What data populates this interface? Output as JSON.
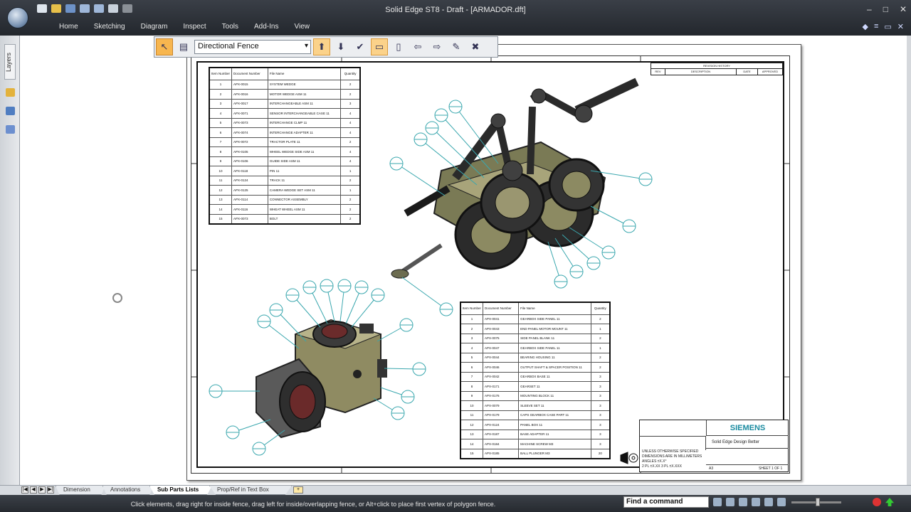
{
  "window": {
    "title": "Solid Edge ST8 - Draft - [ARMADOR.dft]",
    "controls": {
      "minimize": "–",
      "maximize": "□",
      "close": "✕"
    }
  },
  "ribbon": {
    "tabs": [
      "Home",
      "Sketching",
      "Diagram",
      "Inspect",
      "Tools",
      "Add-Ins",
      "View"
    ]
  },
  "left_pane": {
    "layers_tab": "Layers"
  },
  "select_toolbar": {
    "fence_mode": "Directional Fence",
    "fence_options": [
      "Directional Fence"
    ]
  },
  "bom_top": {
    "headers": [
      "Item Number",
      "Document Number",
      "File Name",
      "Quantity"
    ],
    "rows": [
      [
        "1",
        "APX-0015",
        "SYSTEM WEDGE",
        "2"
      ],
      [
        "2",
        "APX-0016",
        "MOTOR WEDGE ASM 11",
        "2"
      ],
      [
        "3",
        "APX-0017",
        "INTERCHANGEABLE ASM 11",
        "3"
      ],
      [
        "4",
        "APX-0071",
        "SENSOR INTERCHANGEABLE CASE 11",
        "4"
      ],
      [
        "5",
        "APX-0073",
        "INTERCHANGE CLMP 11",
        "4"
      ],
      [
        "6",
        "APX-0074",
        "INTERCHANGE ADAPTER 11",
        "4"
      ],
      [
        "7",
        "APX-0072",
        "TRACTOR PLATE 11",
        "2"
      ],
      [
        "8",
        "APX-0105",
        "WHEEL WEDGE SIDE ASM 11",
        "4"
      ],
      [
        "9",
        "APX-0106",
        "GUIDE SIDE ASM 11",
        "4"
      ],
      [
        "10",
        "APX-0118",
        "PIN 11",
        "1"
      ],
      [
        "11",
        "APX-0124",
        "TRACK 11",
        "2"
      ],
      [
        "12",
        "APX-0125",
        "CAMERA WEDGE SET ASM 11",
        "1"
      ],
      [
        "13",
        "APX-0114",
        "CONNECTOR ASSEMBLY",
        "2"
      ],
      [
        "14",
        "APX-0116",
        "WHEAT WHEEL ASM 11",
        "2"
      ],
      [
        "15",
        "APX-0073",
        "BOLT",
        "2"
      ]
    ]
  },
  "bom_bottom": {
    "headers": [
      "Item Number",
      "Document Number",
      "File Name",
      "Quantity"
    ],
    "rows": [
      [
        "1",
        "APX-0041",
        "GEARBOX SIDE PANEL 11",
        "2"
      ],
      [
        "2",
        "APX-0043",
        "END PANEL MOTOR MOUNT 11",
        "1"
      ],
      [
        "3",
        "APX-0075",
        "SIDE PANEL BLANK 11",
        "2"
      ],
      [
        "4",
        "APX-0047",
        "GEARBOX SIDE PANEL 11",
        "1"
      ],
      [
        "5",
        "APX-0044",
        "BEARING HOUSING 11",
        "2"
      ],
      [
        "6",
        "APX-0046",
        "OUTPUT SHAFT & SPACER POSITION 11",
        "2"
      ],
      [
        "7",
        "APX-0042",
        "GEARBOX BASE 11",
        "3"
      ],
      [
        "8",
        "APX-0171",
        "GEARSET 11",
        "3"
      ],
      [
        "9",
        "APX-0176",
        "MOUNTING BLOCK 11",
        "3"
      ],
      [
        "10",
        "APX-0079",
        "SLEEVE SET 11",
        "3"
      ],
      [
        "11",
        "APX-0179",
        "CAPS GEARBOX CASE PART 11",
        "3"
      ],
      [
        "12",
        "APX-0124",
        "PANEL BOX 11",
        "3"
      ],
      [
        "13",
        "APX-0187",
        "BASE ADAPTER 11",
        "3"
      ],
      [
        "14",
        "APX-0184",
        "MACHINE SCREW M3",
        "3"
      ],
      [
        "15",
        "APX-0185",
        "BALL PLUNGER M3",
        "20"
      ]
    ]
  },
  "revision_block": {
    "title": "REVISION HISTORY",
    "cols": [
      "REV",
      "DESCRIPTION",
      "DATE",
      "APPROVED"
    ]
  },
  "title_block": {
    "brand": "SIEMENS",
    "line1": "Solid Edge Design Better",
    "notes": [
      "UNLESS OTHERWISE SPECIFIED",
      "DIMENSIONS ARE IN MILLIMETERS",
      "ANGLES ±X.X°",
      "2 PL ±X.XX 3 PL ±X.XXX"
    ],
    "size": "A3",
    "sheet": "SHEET 1 OF 1"
  },
  "sheet_tabs": {
    "items": [
      "Dimension",
      "Annotations",
      "Sub Parts Lists",
      "Prop/Ref in Text Box"
    ],
    "current": "Sub Parts Lists"
  },
  "status": {
    "prompt": "Click elements, drag right for inside fence, drag left for inside/overlapping fence, or Alt+click to place first vertex of polygon fence.",
    "command_search": "Find a command"
  },
  "colors": {
    "accent": "#f7b64f",
    "balloon": "#3aa7ae",
    "siemens": "#1a8ba0"
  }
}
